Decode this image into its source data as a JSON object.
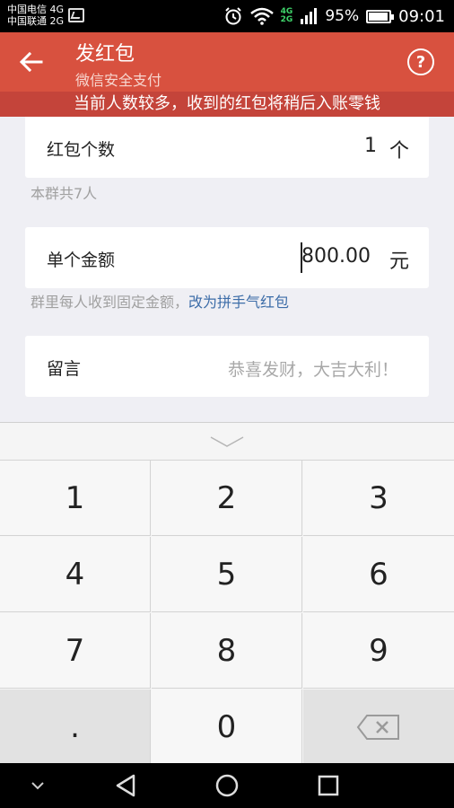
{
  "status_bar": {
    "carrier_1": "中国电信 4G",
    "carrier_2": "中国联通 2G",
    "net_a": "4G",
    "net_b": "2G",
    "battery": "95%",
    "time": "09:01"
  },
  "header": {
    "title": "发红包",
    "subtitle": "微信安全支付",
    "help_label": "?"
  },
  "notice": "当前人数较多，收到的红包将稍后入账零钱",
  "form": {
    "count": {
      "label": "红包个数",
      "value": "1",
      "unit": "个"
    },
    "group_hint": "本群共7人",
    "amount": {
      "label": "单个金额",
      "value": "800.00",
      "unit": "元"
    },
    "amount_hint": "群里每人收到固定金额，",
    "amount_link": "改为拼手气红包",
    "message": {
      "label": "留言",
      "placeholder": "恭喜发财，大吉大利！"
    }
  },
  "keypad": {
    "keys": [
      "1",
      "2",
      "3",
      "4",
      "5",
      "6",
      "7",
      "8",
      "9",
      ".",
      "0"
    ]
  },
  "colors": {
    "header": "#d8513f",
    "notice": "#c4443a",
    "link": "#3d6da8"
  }
}
